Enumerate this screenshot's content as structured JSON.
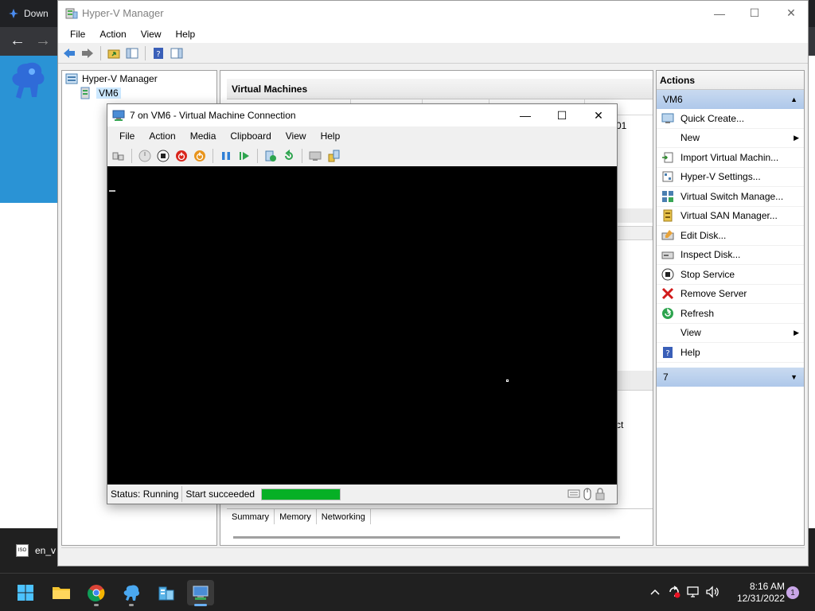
{
  "background_browser": {
    "tab_title": "Down",
    "back_glyph": "←",
    "forward_glyph": "→"
  },
  "hyperv_manager": {
    "window_title": "Hyper-V Manager",
    "window_controls": {
      "minimize": "—",
      "maximize": "☐",
      "close": "✕"
    },
    "menu": [
      "File",
      "Action",
      "View",
      "Help"
    ],
    "tree": {
      "root": "Hyper-V Manager",
      "child": "VM6"
    },
    "center": {
      "section_title": "Virtual Machines",
      "uptime_partial": "01",
      "connect_partial": "ct"
    },
    "details_tabs": [
      "Summary",
      "Memory",
      "Networking"
    ],
    "actions": {
      "title": "Actions",
      "group1": "VM6",
      "items": [
        {
          "label": "Quick Create...",
          "icon": "quick-create-icon"
        },
        {
          "label": "New",
          "icon": "none",
          "submenu": true
        },
        {
          "label": "Import Virtual Machin...",
          "icon": "import-icon"
        },
        {
          "label": "Hyper-V Settings...",
          "icon": "settings-icon"
        },
        {
          "label": "Virtual Switch Manage...",
          "icon": "switch-icon"
        },
        {
          "label": "Virtual SAN Manager...",
          "icon": "san-icon"
        },
        {
          "label": "Edit Disk...",
          "icon": "edit-disk-icon"
        },
        {
          "label": "Inspect Disk...",
          "icon": "inspect-disk-icon"
        },
        {
          "label": "Stop Service",
          "icon": "stop-icon"
        },
        {
          "label": "Remove Server",
          "icon": "remove-icon"
        },
        {
          "label": "Refresh",
          "icon": "refresh-icon"
        },
        {
          "label": "View",
          "icon": "none",
          "submenu": true
        },
        {
          "label": "Help",
          "icon": "help-icon"
        }
      ],
      "group2": "7"
    }
  },
  "vm_connection": {
    "window_title": "7 on VM6 - Virtual Machine Connection",
    "window_controls": {
      "minimize": "—",
      "maximize": "☐",
      "close": "✕"
    },
    "menu": [
      "File",
      "Action",
      "Media",
      "Clipboard",
      "View",
      "Help"
    ],
    "status_label": "Status: Running",
    "start_message": "Start succeeded",
    "progress_fraction": 1.0
  },
  "dark_strip": {
    "file_label": "en_v"
  },
  "taskbar": {
    "clock_time": "8:16 AM",
    "clock_date": "12/31/2022",
    "notification_count": "1"
  },
  "colors": {
    "accent_blue": "#2a93d5",
    "progress_green": "#06b025",
    "selection": "#cce8ff",
    "action_group": "#aec8ea"
  }
}
